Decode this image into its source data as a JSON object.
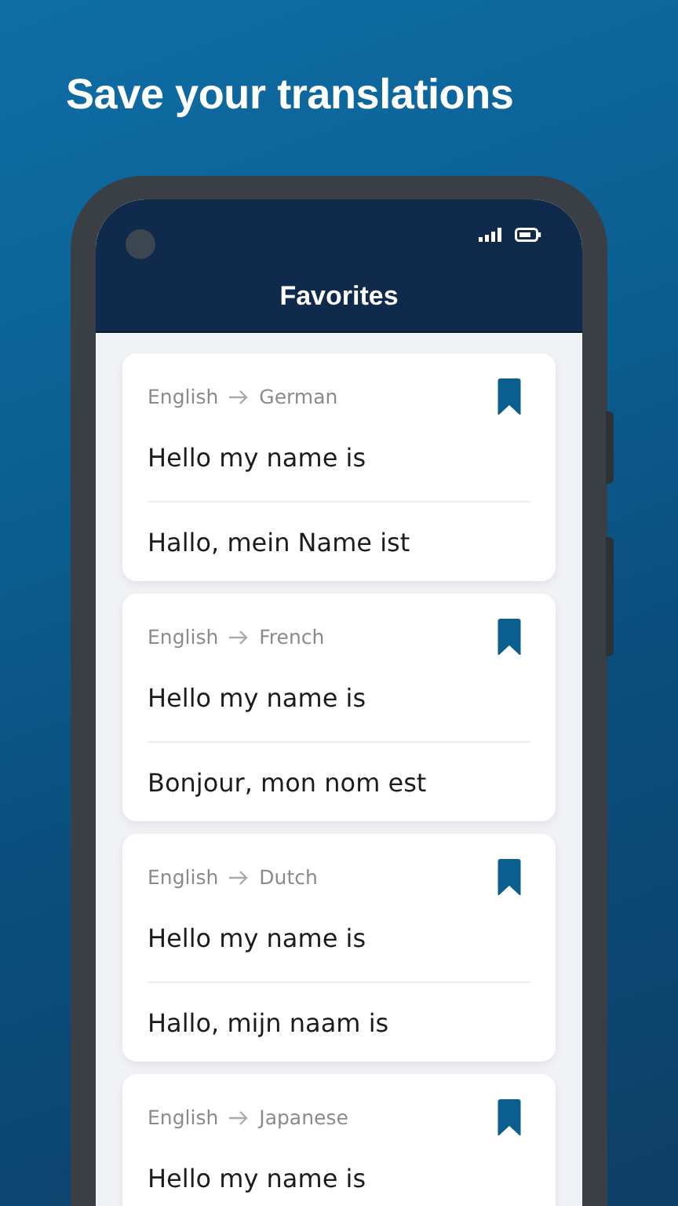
{
  "headline": "Save your translations",
  "screen": {
    "title": "Favorites"
  },
  "favorites": [
    {
      "from": "English",
      "to": "German",
      "source": "Hello my name is",
      "translation": "Hallo, mein Name ist",
      "bookmarked": true
    },
    {
      "from": "English",
      "to": "French",
      "source": "Hello my name is",
      "translation": "Bonjour, mon nom est",
      "bookmarked": true
    },
    {
      "from": "English",
      "to": "Dutch",
      "source": "Hello my name is",
      "translation": "Hallo, mijn naam is",
      "bookmarked": true
    },
    {
      "from": "English",
      "to": "Japanese",
      "source": "Hello my name is",
      "bookmarked": true
    }
  ]
}
